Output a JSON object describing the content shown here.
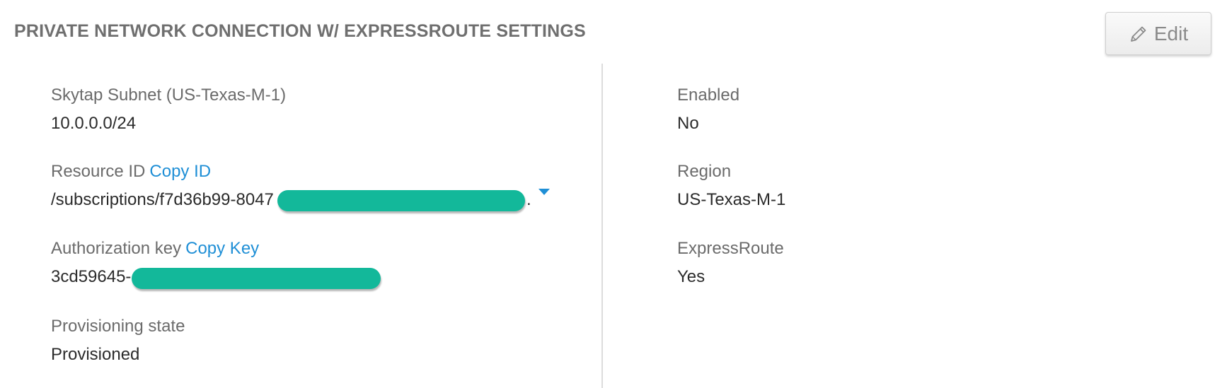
{
  "section": {
    "title": "PRIVATE NETWORK CONNECTION W/ EXPRESSROUTE SETTINGS",
    "edit_label": "Edit"
  },
  "left_fields": {
    "subnet": {
      "label": "Skytap Subnet (US-Texas-M-1)",
      "value": "10.0.0.0/24"
    },
    "resource_id": {
      "label": "Resource ID",
      "link": "Copy ID",
      "value": "/subscriptions/f7d36b99-8047",
      "tail": "."
    },
    "auth_key": {
      "label": "Authorization key",
      "link": "Copy Key",
      "value": "3cd59645-"
    },
    "provisioning": {
      "label": "Provisioning state",
      "value": "Provisioned"
    }
  },
  "right_fields": {
    "enabled": {
      "label": "Enabled",
      "value": "No"
    },
    "region": {
      "label": "Region",
      "value": "US-Texas-M-1"
    },
    "expressroute": {
      "label": "ExpressRoute",
      "value": "Yes"
    }
  },
  "colors": {
    "link": "#1f8fd6",
    "redaction": "#13b89a",
    "label": "#6b6b6b",
    "value": "#2b2b2b"
  },
  "icons": {
    "edit": "pencil-icon",
    "expand": "caret-down-icon"
  }
}
